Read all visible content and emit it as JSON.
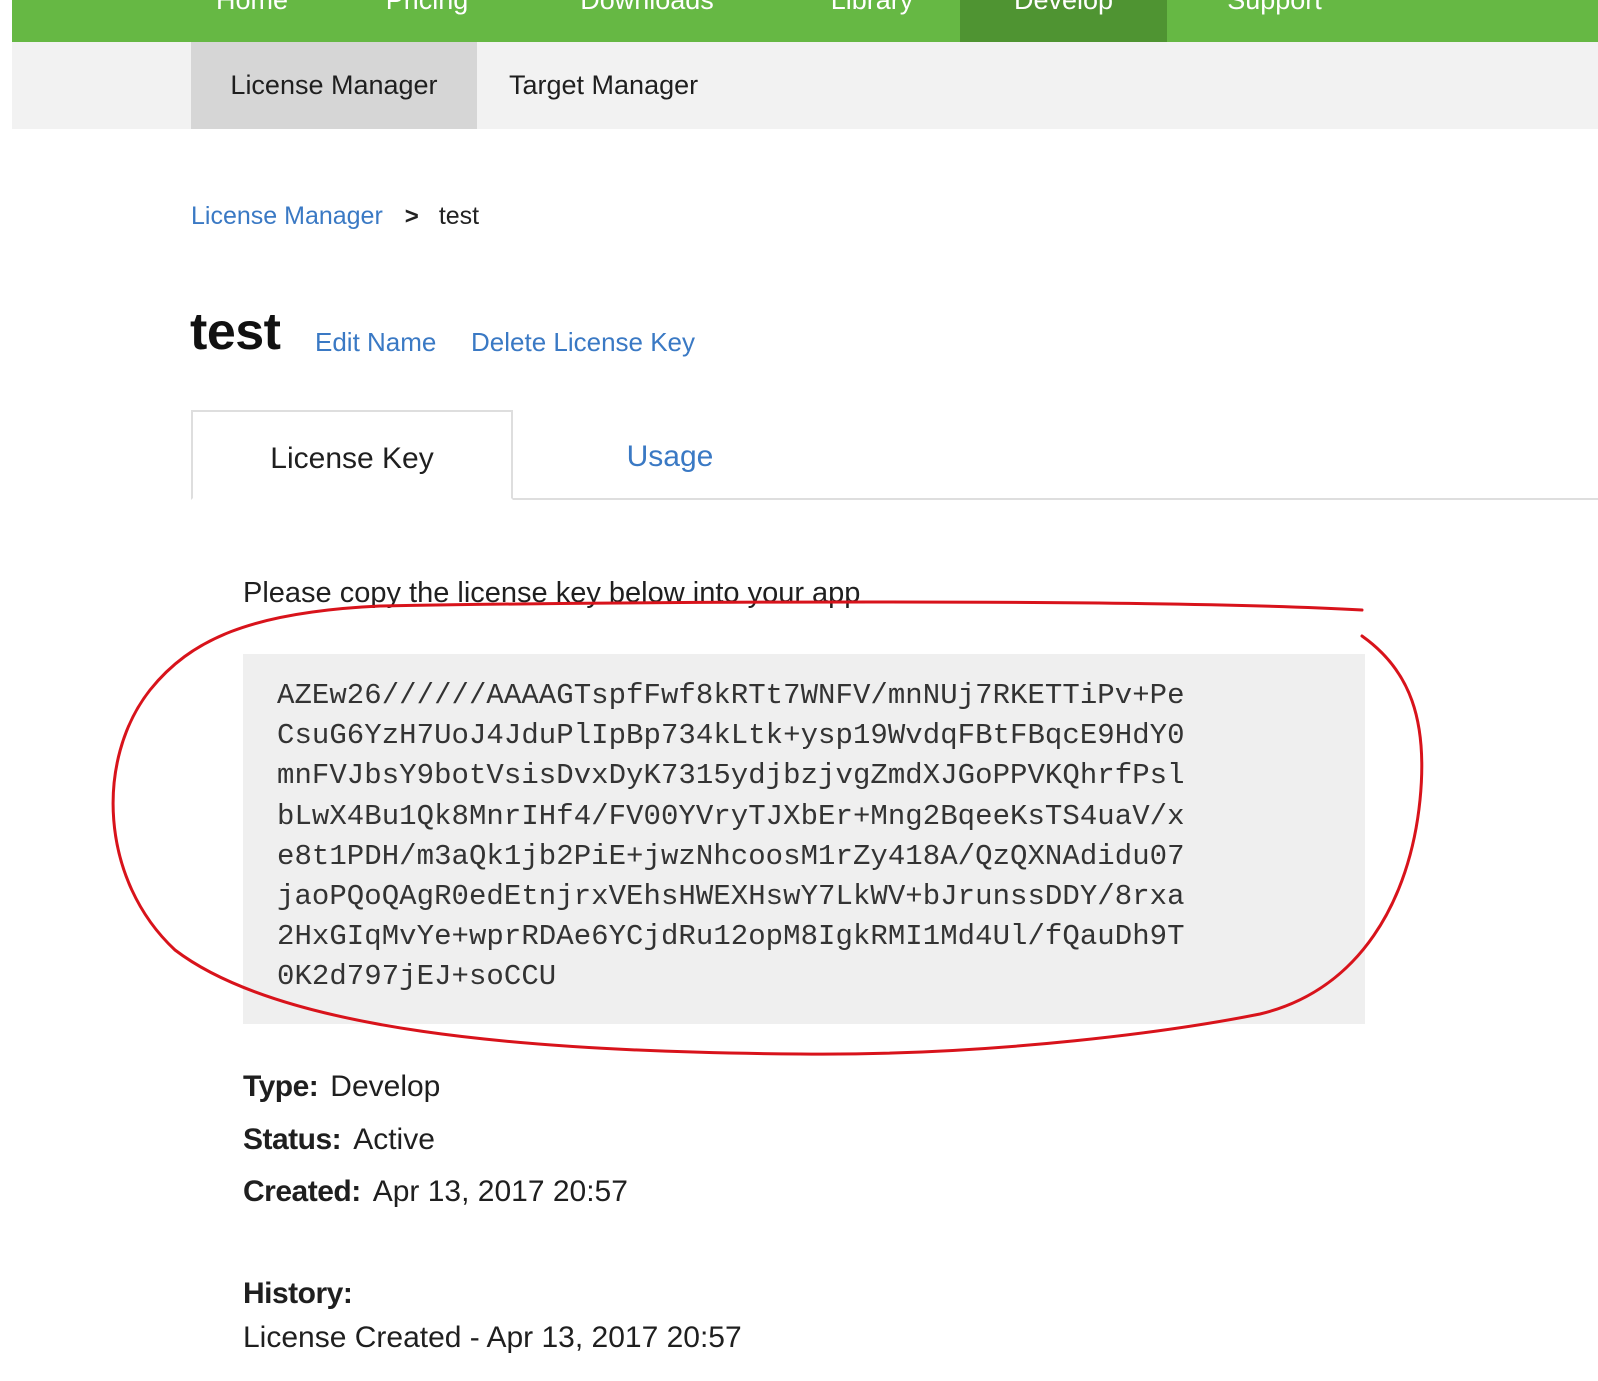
{
  "topnav": {
    "items": [
      {
        "label": "Home",
        "active": false
      },
      {
        "label": "Pricing",
        "active": false
      },
      {
        "label": "Downloads",
        "active": false
      },
      {
        "label": "Library",
        "active": false
      },
      {
        "label": "Develop",
        "active": true
      },
      {
        "label": "Support",
        "active": false
      }
    ]
  },
  "subnav": {
    "items": [
      {
        "label": "License Manager",
        "active": true
      },
      {
        "label": "Target Manager",
        "active": false
      }
    ]
  },
  "breadcrumb": {
    "root": "License Manager",
    "separator": ">",
    "current": "test"
  },
  "license": {
    "name": "test",
    "edit_name_label": "Edit Name",
    "delete_label": "Delete License Key"
  },
  "tabs": [
    {
      "label": "License Key",
      "active": true
    },
    {
      "label": "Usage",
      "active": false
    }
  ],
  "key_panel": {
    "instructions": "Please copy the license key below into your app",
    "key_lines": [
      "AZEw26//////AAAAGTspfFwf8kRTt7WNFV/mnNUj7RKETTiPv+Pe",
      "CsuG6YzH7UoJ4JduPlIpBp734kLtk+ysp19WvdqFBtFBqcE9HdY0",
      "mnFVJbsY9botVsisDvxDyK7315ydjbzjvgZmdXJGoPPVKQhrfPsl",
      "bLwX4Bu1Qk8MnrIHf4/FV00YVryTJXbEr+Mng2BqeeKsTS4uaV/x",
      "e8t1PDH/m3aQk1jb2PiE+jwzNhcoosM1rZy418A/QzQXNAdidu07",
      "jaoPQoQAgR0edEtnjrxVEhsHWEXHswY7LkWV+bJrunssDDY/8rxa",
      "2HxGIqMvYe+wprRDAe6YCjdRu12opM8IgkRMI1Md4Ul/fQauDh9T",
      "0K2d797jEJ+soCCU"
    ]
  },
  "details": {
    "type_label": "Type:",
    "type_value": "Develop",
    "status_label": "Status:",
    "status_value": "Active",
    "created_label": "Created:",
    "created_value": "Apr 13, 2017 20:57",
    "history_label": "History:",
    "history_entry": "License Created - Apr 13, 2017 20:57"
  },
  "colors": {
    "nav_green": "#66b844",
    "nav_active_green": "#4f9432",
    "link_blue": "#3a79c4",
    "annotation_red": "#d8131b",
    "key_bg": "#efefef"
  }
}
